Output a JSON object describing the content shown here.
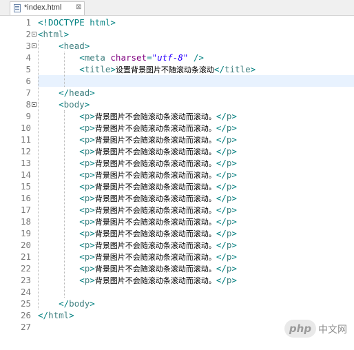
{
  "tab": {
    "title": "*index.html",
    "close_glyph": "⊠",
    "icon": "html-file-icon"
  },
  "editor": {
    "current_line": 6,
    "lines": [
      {
        "n": "1",
        "tokens": [
          [
            "br",
            "<!DOCTYPE html>"
          ]
        ]
      },
      {
        "n": "2",
        "fold": true,
        "tokens": [
          [
            "br",
            "<"
          ],
          [
            "tag",
            "html"
          ],
          [
            "br",
            ">"
          ]
        ]
      },
      {
        "n": "3",
        "fold": true,
        "indent": "    ",
        "tokens": [
          [
            "br",
            "<"
          ],
          [
            "tag",
            "head"
          ],
          [
            "br",
            ">"
          ]
        ]
      },
      {
        "n": "4",
        "indent": "        ",
        "tokens": [
          [
            "br",
            "<"
          ],
          [
            "tag",
            "meta"
          ],
          [
            "plain",
            " "
          ],
          [
            "attr",
            "charset"
          ],
          [
            "br",
            "="
          ],
          [
            "val",
            "\"utf-8\""
          ],
          [
            "plain",
            " "
          ],
          [
            "br",
            "/>"
          ]
        ]
      },
      {
        "n": "5",
        "indent": "        ",
        "tokens": [
          [
            "br",
            "<"
          ],
          [
            "tag",
            "title"
          ],
          [
            "br",
            ">"
          ],
          [
            "txt",
            "设置背景图片不随滚动条滚动"
          ],
          [
            "br",
            "</"
          ],
          [
            "tag",
            "title"
          ],
          [
            "br",
            ">"
          ]
        ]
      },
      {
        "n": "6",
        "tokens": []
      },
      {
        "n": "7",
        "indent": "    ",
        "tokens": [
          [
            "br",
            "</"
          ],
          [
            "tag",
            "head"
          ],
          [
            "br",
            ">"
          ]
        ]
      },
      {
        "n": "8",
        "fold": true,
        "indent": "    ",
        "tokens": [
          [
            "br",
            "<"
          ],
          [
            "tag",
            "body"
          ],
          [
            "br",
            ">"
          ]
        ]
      },
      {
        "n": "9",
        "indent": "        ",
        "tokens": [
          [
            "br",
            "<"
          ],
          [
            "tag",
            "p"
          ],
          [
            "br",
            ">"
          ],
          [
            "txt",
            "背景图片不会随滚动条滚动而滚动。"
          ],
          [
            "br",
            "</"
          ],
          [
            "tag",
            "p"
          ],
          [
            "br",
            ">"
          ]
        ]
      },
      {
        "n": "10",
        "indent": "        ",
        "tokens": [
          [
            "br",
            "<"
          ],
          [
            "tag",
            "p"
          ],
          [
            "br",
            ">"
          ],
          [
            "txt",
            "背景图片不会随滚动条滚动而滚动。"
          ],
          [
            "br",
            "</"
          ],
          [
            "tag",
            "p"
          ],
          [
            "br",
            ">"
          ]
        ]
      },
      {
        "n": "11",
        "indent": "        ",
        "tokens": [
          [
            "br",
            "<"
          ],
          [
            "tag",
            "p"
          ],
          [
            "br",
            ">"
          ],
          [
            "txt",
            "背景图片不会随滚动条滚动而滚动。"
          ],
          [
            "br",
            "</"
          ],
          [
            "tag",
            "p"
          ],
          [
            "br",
            ">"
          ]
        ]
      },
      {
        "n": "12",
        "indent": "        ",
        "tokens": [
          [
            "br",
            "<"
          ],
          [
            "tag",
            "p"
          ],
          [
            "br",
            ">"
          ],
          [
            "txt",
            "背景图片不会随滚动条滚动而滚动。"
          ],
          [
            "br",
            "</"
          ],
          [
            "tag",
            "p"
          ],
          [
            "br",
            ">"
          ]
        ]
      },
      {
        "n": "13",
        "indent": "        ",
        "tokens": [
          [
            "br",
            "<"
          ],
          [
            "tag",
            "p"
          ],
          [
            "br",
            ">"
          ],
          [
            "txt",
            "背景图片不会随滚动条滚动而滚动。"
          ],
          [
            "br",
            "</"
          ],
          [
            "tag",
            "p"
          ],
          [
            "br",
            ">"
          ]
        ]
      },
      {
        "n": "14",
        "indent": "        ",
        "tokens": [
          [
            "br",
            "<"
          ],
          [
            "tag",
            "p"
          ],
          [
            "br",
            ">"
          ],
          [
            "txt",
            "背景图片不会随滚动条滚动而滚动。"
          ],
          [
            "br",
            "</"
          ],
          [
            "tag",
            "p"
          ],
          [
            "br",
            ">"
          ]
        ]
      },
      {
        "n": "15",
        "indent": "        ",
        "tokens": [
          [
            "br",
            "<"
          ],
          [
            "tag",
            "p"
          ],
          [
            "br",
            ">"
          ],
          [
            "txt",
            "背景图片不会随滚动条滚动而滚动。"
          ],
          [
            "br",
            "</"
          ],
          [
            "tag",
            "p"
          ],
          [
            "br",
            ">"
          ]
        ]
      },
      {
        "n": "16",
        "indent": "        ",
        "tokens": [
          [
            "br",
            "<"
          ],
          [
            "tag",
            "p"
          ],
          [
            "br",
            ">"
          ],
          [
            "txt",
            "背景图片不会随滚动条滚动而滚动。"
          ],
          [
            "br",
            "</"
          ],
          [
            "tag",
            "p"
          ],
          [
            "br",
            ">"
          ]
        ]
      },
      {
        "n": "17",
        "indent": "        ",
        "tokens": [
          [
            "br",
            "<"
          ],
          [
            "tag",
            "p"
          ],
          [
            "br",
            ">"
          ],
          [
            "txt",
            "背景图片不会随滚动条滚动而滚动。"
          ],
          [
            "br",
            "</"
          ],
          [
            "tag",
            "p"
          ],
          [
            "br",
            ">"
          ]
        ]
      },
      {
        "n": "18",
        "indent": "        ",
        "tokens": [
          [
            "br",
            "<"
          ],
          [
            "tag",
            "p"
          ],
          [
            "br",
            ">"
          ],
          [
            "txt",
            "背景图片不会随滚动条滚动而滚动。"
          ],
          [
            "br",
            "</"
          ],
          [
            "tag",
            "p"
          ],
          [
            "br",
            ">"
          ]
        ]
      },
      {
        "n": "19",
        "indent": "        ",
        "tokens": [
          [
            "br",
            "<"
          ],
          [
            "tag",
            "p"
          ],
          [
            "br",
            ">"
          ],
          [
            "txt",
            "背景图片不会随滚动条滚动而滚动。"
          ],
          [
            "br",
            "</"
          ],
          [
            "tag",
            "p"
          ],
          [
            "br",
            ">"
          ]
        ]
      },
      {
        "n": "20",
        "indent": "        ",
        "tokens": [
          [
            "br",
            "<"
          ],
          [
            "tag",
            "p"
          ],
          [
            "br",
            ">"
          ],
          [
            "txt",
            "背景图片不会随滚动条滚动而滚动。"
          ],
          [
            "br",
            "</"
          ],
          [
            "tag",
            "p"
          ],
          [
            "br",
            ">"
          ]
        ]
      },
      {
        "n": "21",
        "indent": "        ",
        "tokens": [
          [
            "br",
            "<"
          ],
          [
            "tag",
            "p"
          ],
          [
            "br",
            ">"
          ],
          [
            "txt",
            "背景图片不会随滚动条滚动而滚动。"
          ],
          [
            "br",
            "</"
          ],
          [
            "tag",
            "p"
          ],
          [
            "br",
            ">"
          ]
        ]
      },
      {
        "n": "22",
        "indent": "        ",
        "tokens": [
          [
            "br",
            "<"
          ],
          [
            "tag",
            "p"
          ],
          [
            "br",
            ">"
          ],
          [
            "txt",
            "背景图片不会随滚动条滚动而滚动。"
          ],
          [
            "br",
            "</"
          ],
          [
            "tag",
            "p"
          ],
          [
            "br",
            ">"
          ]
        ]
      },
      {
        "n": "23",
        "indent": "        ",
        "tokens": [
          [
            "br",
            "<"
          ],
          [
            "tag",
            "p"
          ],
          [
            "br",
            ">"
          ],
          [
            "txt",
            "背景图片不会随滚动条滚动而滚动。"
          ],
          [
            "br",
            "</"
          ],
          [
            "tag",
            "p"
          ],
          [
            "br",
            ">"
          ]
        ]
      },
      {
        "n": "24",
        "tokens": []
      },
      {
        "n": "25",
        "indent": "    ",
        "tokens": [
          [
            "br",
            "</"
          ],
          [
            "tag",
            "body"
          ],
          [
            "br",
            ">"
          ]
        ]
      },
      {
        "n": "26",
        "tokens": [
          [
            "br",
            "</"
          ],
          [
            "tag",
            "html"
          ],
          [
            "br",
            ">"
          ]
        ]
      },
      {
        "n": "27",
        "tokens": []
      }
    ]
  },
  "colors": {
    "tag": "#3f7f7f",
    "bracket": "#008080",
    "attribute": "#7f007f",
    "value": "#2a00ff",
    "line_number": "#787878",
    "current_line_bg": "#e8f2fe"
  },
  "watermark": {
    "logo_text": "php",
    "site_text": "中文网"
  }
}
